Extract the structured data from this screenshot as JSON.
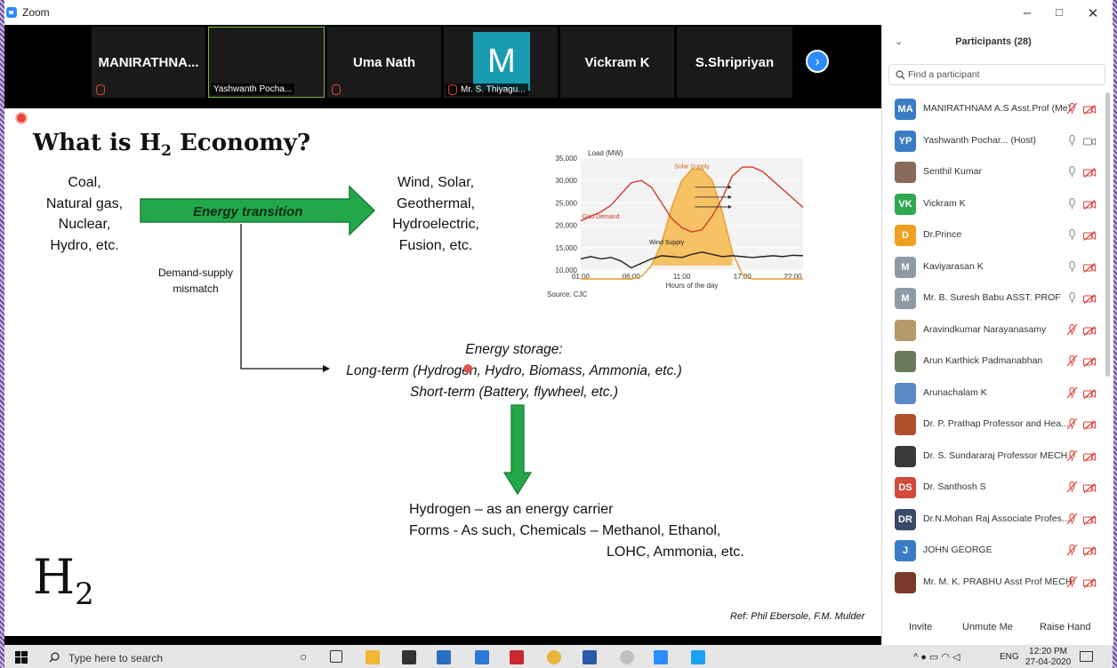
{
  "window": {
    "title": "Zoom",
    "controls": [
      "–",
      "□",
      "✕"
    ]
  },
  "video_strip": {
    "tiles": [
      {
        "name": "MANIRATHNA...",
        "label": ""
      },
      {
        "name": "",
        "label": "Yashwanth Pocha..."
      },
      {
        "name": "Uma Nath",
        "label": ""
      },
      {
        "name": "",
        "avatar": "M",
        "label": "Mr. S. Thiyagu..."
      },
      {
        "name": "Vickram K",
        "label": ""
      },
      {
        "name": "S.Shripriyan",
        "label": ""
      }
    ],
    "next_button": "›"
  },
  "slide": {
    "title": "What is H",
    "title_sub": "2",
    "title_end": " Economy?",
    "sources": [
      "Coal,",
      "Natural gas,",
      "Nuclear,",
      "Hydro, etc."
    ],
    "transition_label": "Energy transition",
    "renewables": [
      "Wind, Solar,",
      "Geothermal,",
      "Hydroelectric,",
      "Fusion, etc."
    ],
    "mismatch": [
      "Demand-supply",
      "mismatch"
    ],
    "storage": [
      "Energy storage:",
      "Long-term (Hydrogen, Hydro, Biomass, Ammonia, etc.)",
      "Short-term (Battery, flywheel, etc.)"
    ],
    "hydrogen": [
      "Hydrogen – as an energy carrier",
      "Forms - As such, Chemicals – Methanol, Ethanol,",
      "LOHC, Ammonia, etc."
    ],
    "h2_big": "H",
    "h2_big_sub": "2",
    "reference": "Ref: Phil Ebersole, F.M. Mulder"
  },
  "chart_data": {
    "type": "line",
    "ylabel": "Load (MW)",
    "xlabel": "Hours of the day",
    "source": "Source: CJC",
    "yticks": [
      "35,000",
      "30,000",
      "25,000",
      "20,000",
      "15,000",
      "10,000"
    ],
    "xticks": [
      "01:00",
      "06:00",
      "11:00",
      "17:00",
      "22:00"
    ],
    "ylim": [
      10000,
      35000
    ],
    "xlim": [
      1,
      23
    ],
    "annotations": [
      "Grid Demand",
      "Solar Supply",
      "Wind Supply"
    ],
    "series": [
      {
        "name": "Grid Demand",
        "color": "#d03a2c",
        "x": [
          1,
          2,
          3,
          4,
          5,
          6,
          7,
          8,
          9,
          10,
          11,
          12,
          13,
          14,
          15,
          16,
          17,
          18,
          19,
          20,
          21,
          22,
          23
        ],
        "y": [
          21000,
          22000,
          23000,
          24500,
          27000,
          29500,
          30000,
          28500,
          25000,
          21500,
          19500,
          18500,
          19000,
          22000,
          26000,
          31000,
          33000,
          33000,
          32000,
          30000,
          28000,
          26000,
          24000
        ]
      },
      {
        "name": "Solar Supply",
        "color": "#e8a33a",
        "x": [
          1,
          2,
          3,
          4,
          5,
          6,
          7,
          8,
          9,
          10,
          11,
          12,
          13,
          14,
          15,
          16,
          17,
          18,
          19,
          20,
          21,
          22,
          23
        ],
        "y": [
          8000,
          8000,
          8000,
          8000,
          8000,
          8000,
          8500,
          11000,
          16000,
          24000,
          30000,
          32500,
          32500,
          30000,
          23000,
          14000,
          9000,
          8000,
          8000,
          8000,
          8000,
          8000,
          8000
        ]
      },
      {
        "name": "Wind Supply",
        "color": "#222222",
        "x": [
          1,
          2,
          3,
          4,
          5,
          6,
          7,
          8,
          9,
          10,
          11,
          12,
          13,
          14,
          15,
          16,
          17,
          18,
          19,
          20,
          21,
          22,
          23
        ],
        "y": [
          12500,
          13000,
          12500,
          12800,
          12000,
          10500,
          11500,
          12500,
          13200,
          13000,
          12800,
          13500,
          14000,
          13500,
          13000,
          13200,
          13000,
          12800,
          13000,
          13200,
          13000,
          13300,
          13200
        ]
      }
    ]
  },
  "panel": {
    "title": "Participants (28)",
    "search_placeholder": "Find a participant",
    "participants": [
      {
        "initials": "MA",
        "color": "#3a7dc6",
        "name": "MANIRATHNAM A.S Asst.Prof (Me)",
        "muted": true,
        "video": false
      },
      {
        "initials": "YP",
        "color": "#3a7dc6",
        "name": "Yashwanth Pochar... (Host)",
        "muted": false,
        "video": true
      },
      {
        "initials": "",
        "color": "#8a6a5a",
        "name": "Senthil Kumar",
        "muted": false,
        "video": false
      },
      {
        "initials": "VK",
        "color": "#2fa84f",
        "name": "Vickram K",
        "muted": false,
        "video": false
      },
      {
        "initials": "D",
        "color": "#f0a020",
        "name": "Dr.Prince",
        "muted": false,
        "video": false
      },
      {
        "initials": "M",
        "color": "#8e9aa6",
        "name": "Kaviyarasan K",
        "muted": false,
        "video": false
      },
      {
        "initials": "M",
        "color": "#8e9aa6",
        "name": "Mr. B. Suresh Babu ASST. PROF",
        "muted": false,
        "video": false
      },
      {
        "initials": "",
        "color": "#b59a6a",
        "name": "Aravindkumar Narayanasamy",
        "muted": true,
        "video": false
      },
      {
        "initials": "",
        "color": "#6b7a5a",
        "name": "Arun Karthick Padmanabhan",
        "muted": true,
        "video": false
      },
      {
        "initials": "",
        "color": "#5a8ac6",
        "name": "Arunachalam K",
        "muted": true,
        "video": false
      },
      {
        "initials": "",
        "color": "#b0502a",
        "name": "Dr. P. Prathap Professor and Hea...",
        "muted": true,
        "video": false
      },
      {
        "initials": "",
        "color": "#3a3a3a",
        "name": "Dr. S. Sundararaj Professor MECH",
        "muted": true,
        "video": false
      },
      {
        "initials": "DS",
        "color": "#d04a3a",
        "name": "Dr. Santhosh S",
        "muted": true,
        "video": false
      },
      {
        "initials": "DR",
        "color": "#3a4a6a",
        "name": "Dr.N.Mohan Raj Associate Profes...",
        "muted": true,
        "video": false
      },
      {
        "initials": "J",
        "color": "#3a7dc6",
        "name": "JOHN GEORGE",
        "muted": true,
        "video": false
      },
      {
        "initials": "",
        "color": "#7a3a2a",
        "name": "Mr. M. K. PRABHU Asst Prof MECH",
        "muted": true,
        "video": false
      }
    ],
    "buttons": [
      "Invite",
      "Unmute Me",
      "Raise Hand"
    ]
  },
  "taskbar": {
    "search_placeholder": "Type here to search",
    "time": "12:20 PM",
    "date": "27-04-2020",
    "language": "ENG"
  }
}
